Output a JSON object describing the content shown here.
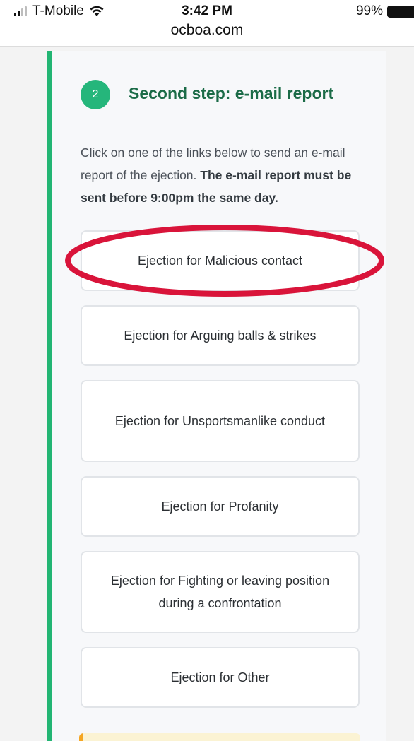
{
  "status_bar": {
    "carrier": "T-Mobile",
    "time": "3:42 PM",
    "url": "ocboa.com",
    "battery": "99%",
    "icons": [
      "signal-icon",
      "wifi-icon",
      "battery-icon"
    ]
  },
  "step": {
    "number": "2",
    "title": "Second step: e-mail report",
    "instruction_text": "Click on one of the links below to send an e-mail report of the ejection.",
    "instruction_bold": "The e-mail report must be sent before 9:00pm the same day."
  },
  "report_buttons": [
    "Ejection for Malicious contact",
    "Ejection for Arguing balls & strikes",
    "Ejection for Unsportsmanlike conduct",
    "Ejection for Profanity",
    "Ejection for Fighting or leaving position during a confrontation",
    "Ejection for Other"
  ],
  "colors": {
    "accent_green": "#22b573",
    "title_green": "#1b6b47",
    "highlight_red": "#d9143a",
    "notice_orange": "#f5a623"
  }
}
